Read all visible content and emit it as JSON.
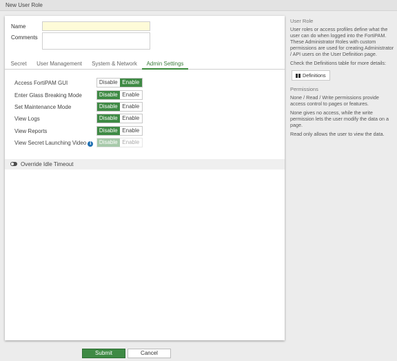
{
  "window": {
    "title": "New User Role"
  },
  "form": {
    "name_label": "Name",
    "name_value": "",
    "comments_label": "Comments",
    "comments_value": ""
  },
  "tabs": [
    {
      "label": "Secret"
    },
    {
      "label": "User Management"
    },
    {
      "label": "System & Network"
    },
    {
      "label": "Admin Settings",
      "active": true
    }
  ],
  "permissions": [
    {
      "label": "Access FortiPAM GUI",
      "disable": "Disable",
      "enable": "Enable",
      "selected": "enable"
    },
    {
      "label": "Enter Glass Breaking Mode",
      "disable": "Disable",
      "enable": "Enable",
      "selected": "disable"
    },
    {
      "label": "Set Maintenance Mode",
      "disable": "Disable",
      "enable": "Enable",
      "selected": "disable"
    },
    {
      "label": "View Logs",
      "disable": "Disable",
      "enable": "Enable",
      "selected": "disable"
    },
    {
      "label": "View Reports",
      "disable": "Disable",
      "enable": "Enable",
      "selected": "disable"
    },
    {
      "label": "View Secret Launching Video",
      "disable": "Disable",
      "enable": "Enable",
      "selected": "disable",
      "disabled": true,
      "has_info": true
    }
  ],
  "override": {
    "label": "Override Idle Timeout",
    "on": false
  },
  "buttons": {
    "submit": "Submit",
    "cancel": "Cancel"
  },
  "side": {
    "user_role_heading": "User Role",
    "user_role_text": "User roles or access profiles define what the user can do when logged into the FortiPAM. These Administrator Roles with custom permissions are used for creating Administrator / API users on the User Definition page.",
    "check_text": "Check the Definitions table for more details:",
    "definitions_button": "Definitions",
    "permissions_heading": "Permissions",
    "perm_text_1": "None / Read / Write permissions provide access control to pages or features.",
    "perm_text_2": "None gives no access, while the write permission lets the user modify the data on a page.",
    "perm_text_3": "Read only allows the user to view the data."
  },
  "colors": {
    "accent": "#3e8a44",
    "name_field_bg": "#fefbd8",
    "info": "#1f6fb2"
  }
}
